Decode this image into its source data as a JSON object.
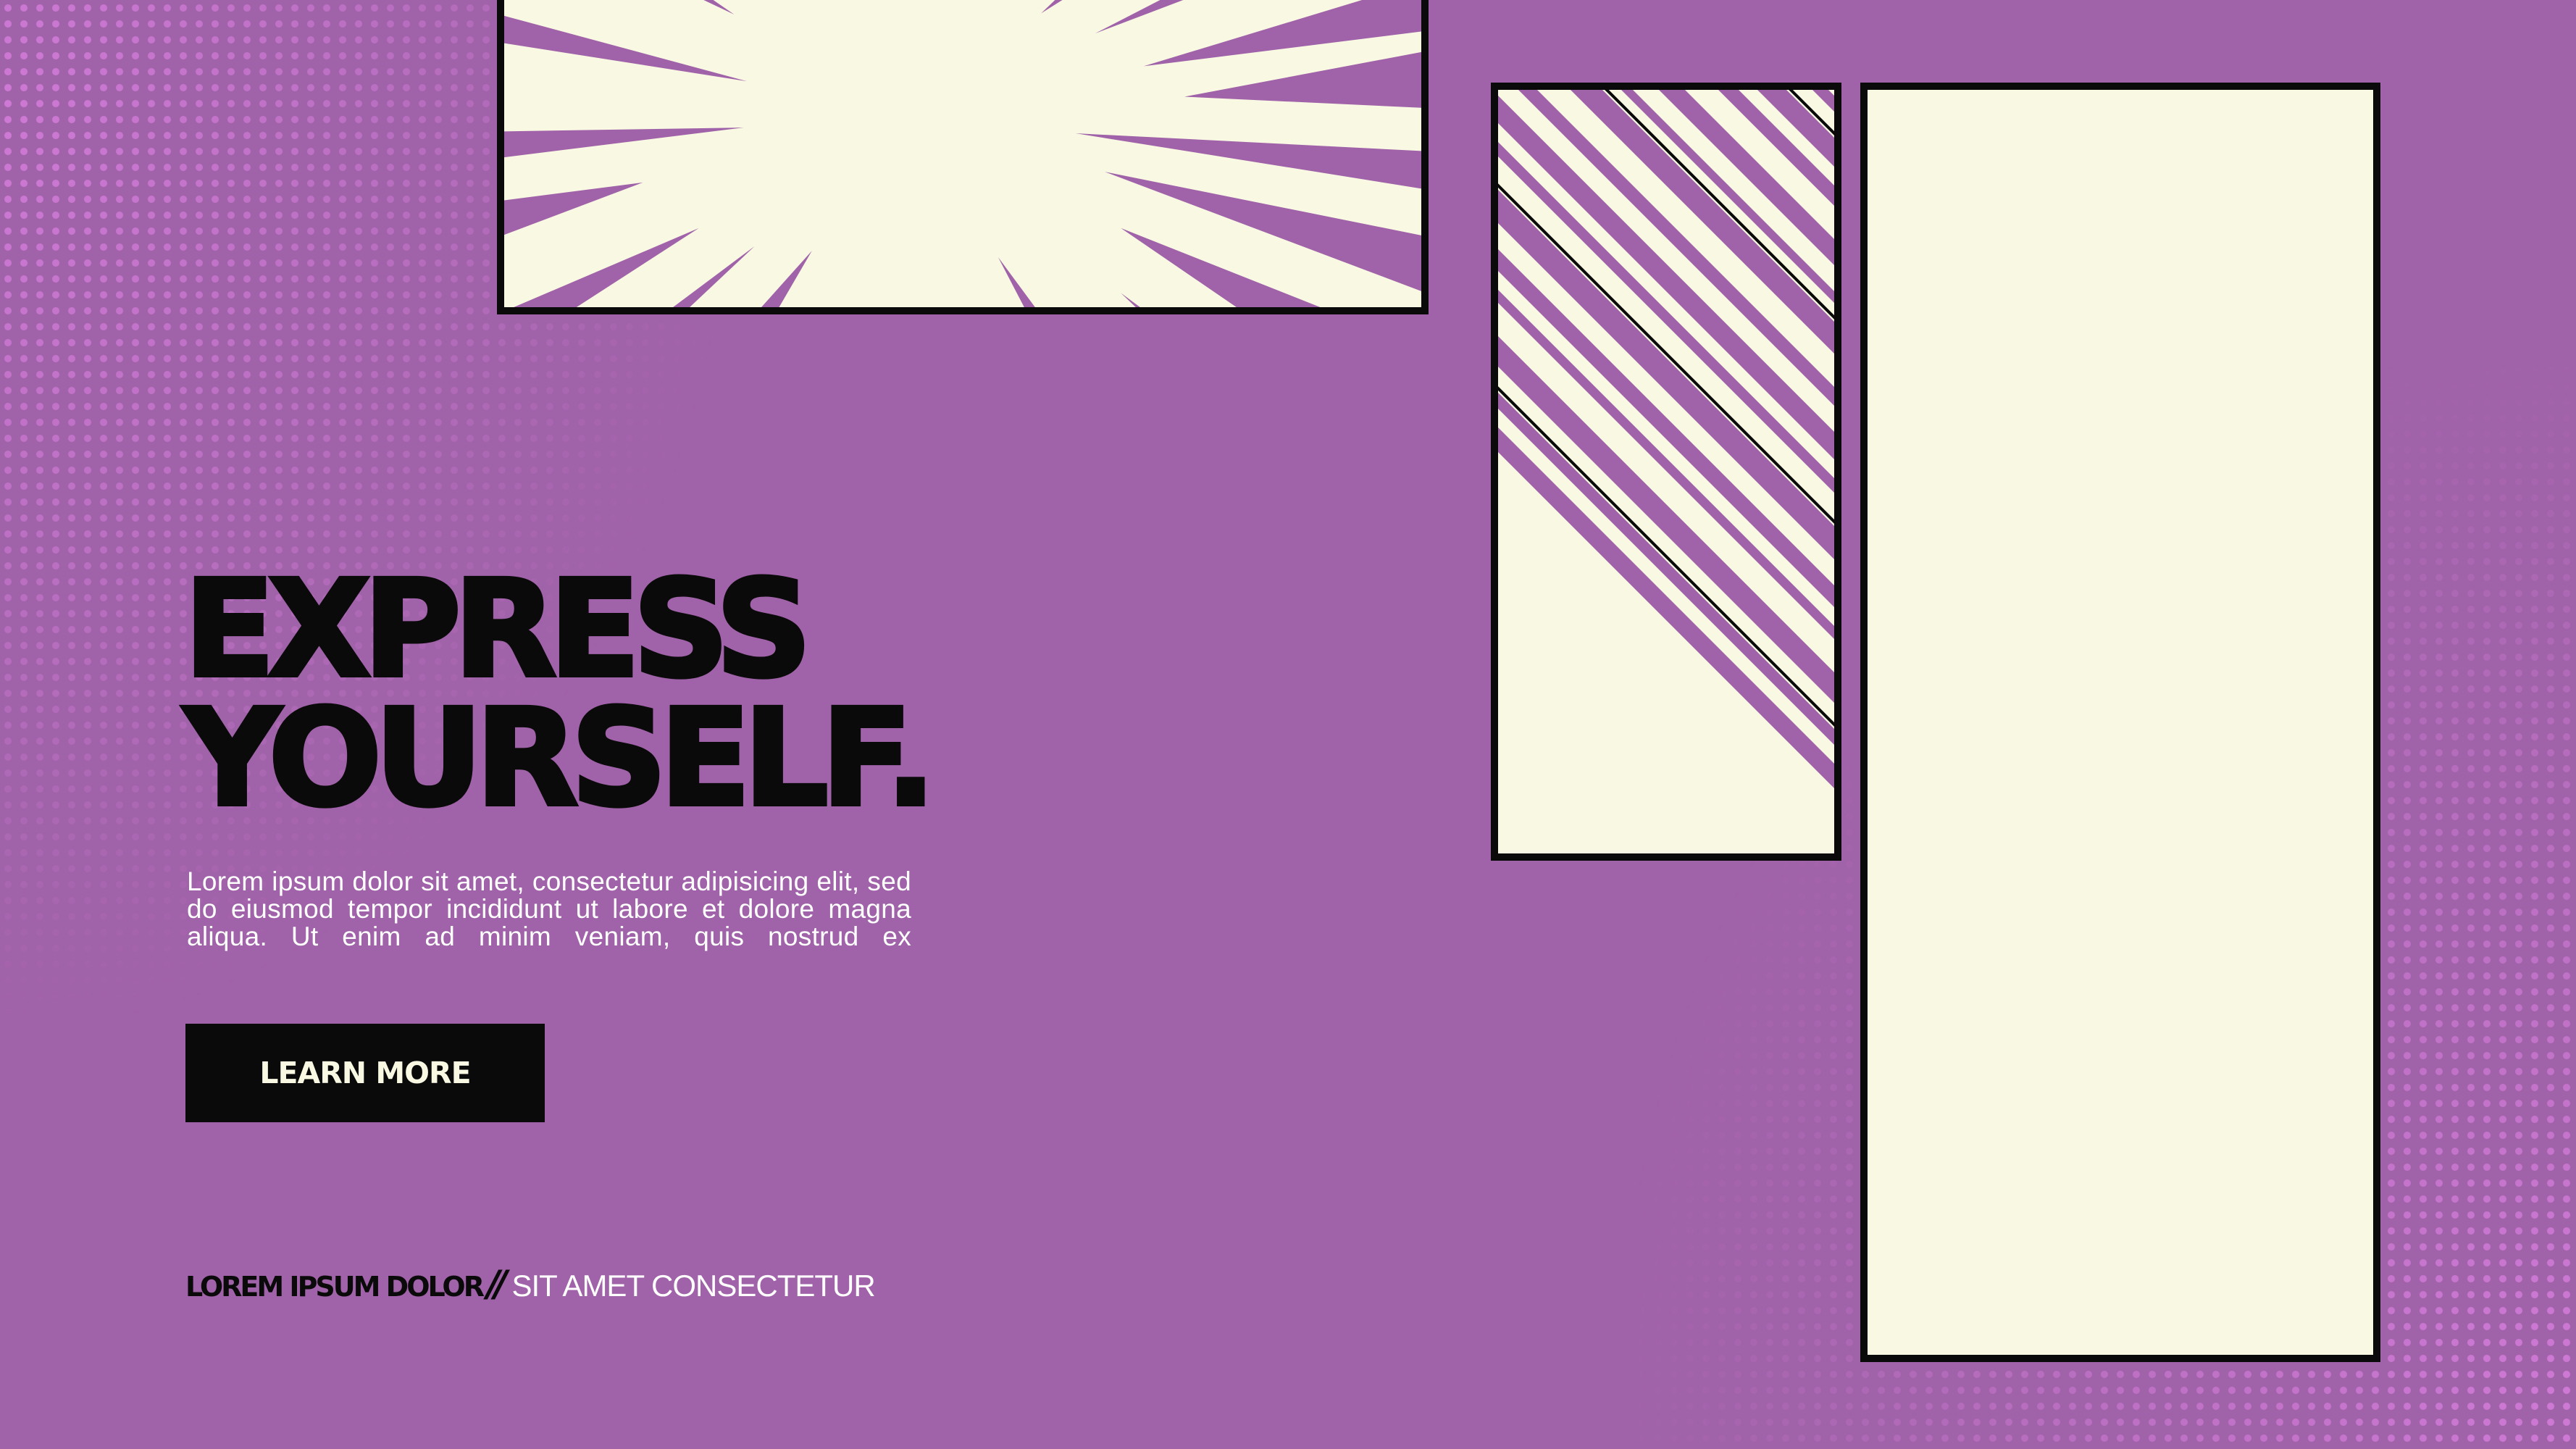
{
  "hero": {
    "headline_line1": "EXPRESS",
    "headline_line2": "YOURSELF.",
    "body": "Lorem ipsum dolor sit amet, consectetur adipisicing elit, sed do eiusmod tempor incididunt ut labore et dolore magna aliqua. Ut enim ad minim veniam, quis nostrud ex",
    "cta_label": "LEARN MORE"
  },
  "footer": {
    "strong": "LOREM IPSUM DOLOR",
    "separator": "//",
    "light": "SIT AMET CONSECTETUR"
  },
  "colors": {
    "background": "#a062a8",
    "panel": "#f8f8e3",
    "ink": "#0a0a0a",
    "halftone": "#de82e4"
  }
}
